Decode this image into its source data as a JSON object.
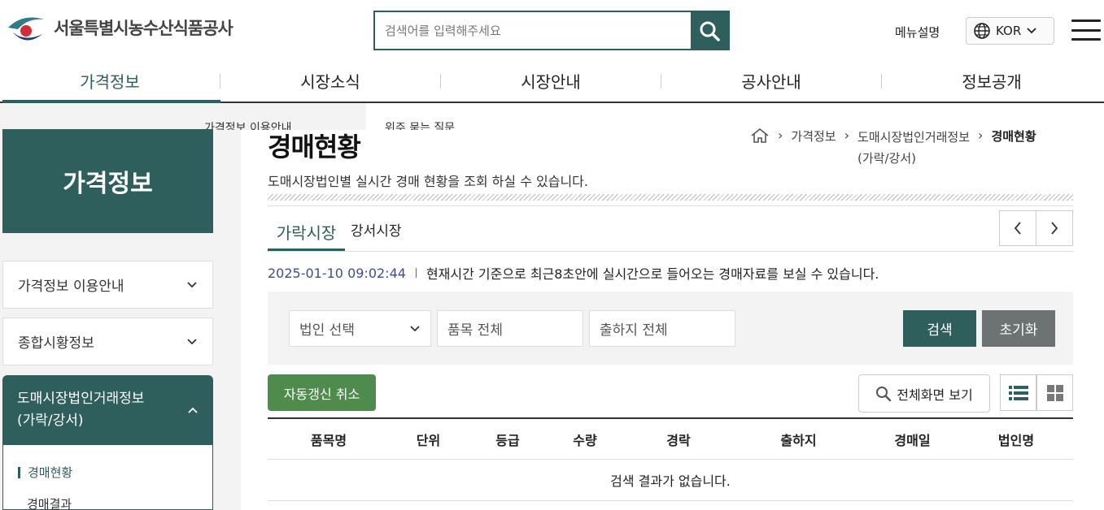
{
  "header": {
    "logo_text": "서울특별시농수산식품공사",
    "search_placeholder": "검색어를 입력해주세요",
    "menu_desc": "메뉴설명",
    "lang": "KOR"
  },
  "gnb": [
    "가격정보",
    "시장소식",
    "시장안내",
    "공사안내",
    "정보공개"
  ],
  "dropdown_peek": [
    "가격정보 이용안내",
    "위주 묻는 질문"
  ],
  "sidebar": {
    "title": "가격정보",
    "items": [
      "가격정보 이용안내",
      "종합시황정보"
    ],
    "active_line1": "도매시장법인거래정보",
    "active_line2": "(가락/강서)",
    "sub_items": [
      "경매현황",
      "경매결과"
    ]
  },
  "content": {
    "title": "경매현황",
    "desc": "도매시장법인별 실시간 경매 현황을 조회 하실 수 있습니다.",
    "breadcrumb": [
      "가격정보",
      "도매시장법인거래정보",
      "경매현황",
      "(가락/강서)"
    ],
    "tabs": [
      "가락시장",
      "강서시장"
    ],
    "timestamp": "2025-01-10 09:02:44",
    "time_info": "현재시간 기준으로 최근8초안에 실시간으로 들어오는 경매자료를 보실 수 있습니다.",
    "filters": [
      "법인 선택",
      "품목 전체",
      "출하지 전체"
    ],
    "btn_search": "검색",
    "btn_reset": "초기화",
    "btn_auto": "자동갱신 취소",
    "btn_full": "전체화면 보기",
    "columns": [
      "품목명",
      "단위",
      "등급",
      "수량",
      "경락",
      "출하지",
      "경매일",
      "법인명"
    ],
    "empty": "검색 결과가 없습니다."
  },
  "colors": {
    "primary": "#2f5f5d",
    "green_button": "#4e8b4c",
    "reset_button": "#6d7272"
  }
}
